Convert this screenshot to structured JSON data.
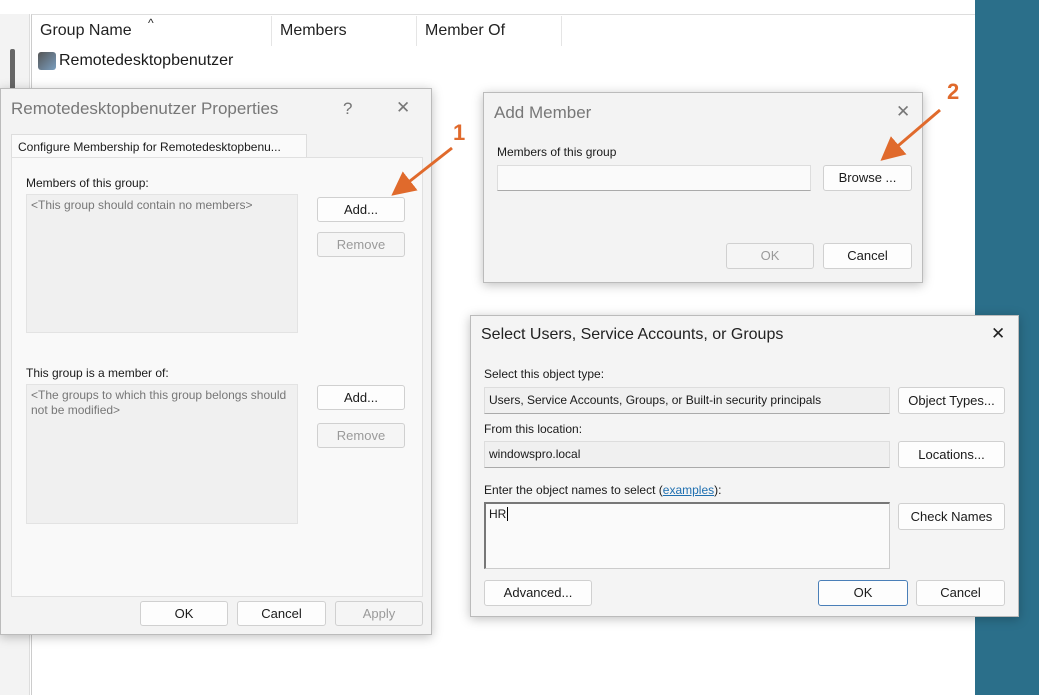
{
  "list": {
    "columns": [
      "Group Name",
      "Members",
      "Member Of"
    ],
    "rows": [
      {
        "name": "Remotedesktopbenutzer"
      }
    ],
    "sort_indicator": "^"
  },
  "props": {
    "title": "Remotedesktopbenutzer Properties",
    "help": "?",
    "close": "✕",
    "tab": "Configure Membership for Remotedesktopbenu...",
    "members_label": "Members of this group:",
    "members_placeholder": "<This group should contain no members>",
    "memberof_label": "This group is a member of:",
    "memberof_placeholder": "<The groups to which this group belongs should not be modified>",
    "add": "Add...",
    "remove": "Remove",
    "ok": "OK",
    "cancel": "Cancel",
    "apply": "Apply"
  },
  "addmember": {
    "title": "Add Member",
    "close": "✕",
    "label": "Members of this group",
    "value": "",
    "browse": "Browse ...",
    "ok": "OK",
    "cancel": "Cancel"
  },
  "select": {
    "title": "Select Users, Service Accounts, or Groups",
    "close": "✕",
    "type_label": "Select this object type:",
    "type_value": "Users, Service Accounts, Groups, or Built-in security principals",
    "object_types": "Object Types...",
    "location_label": "From this location:",
    "location_value": "windowspro.local",
    "locations": "Locations...",
    "names_label_pre": "Enter the object names to select (",
    "names_link": "examples",
    "names_label_post": "):",
    "names_value": "HR",
    "check_names": "Check Names",
    "advanced": "Advanced...",
    "ok": "OK",
    "cancel": "Cancel"
  },
  "annotations": {
    "step1": "1",
    "step2": "2",
    "color": "#e06a2c"
  }
}
